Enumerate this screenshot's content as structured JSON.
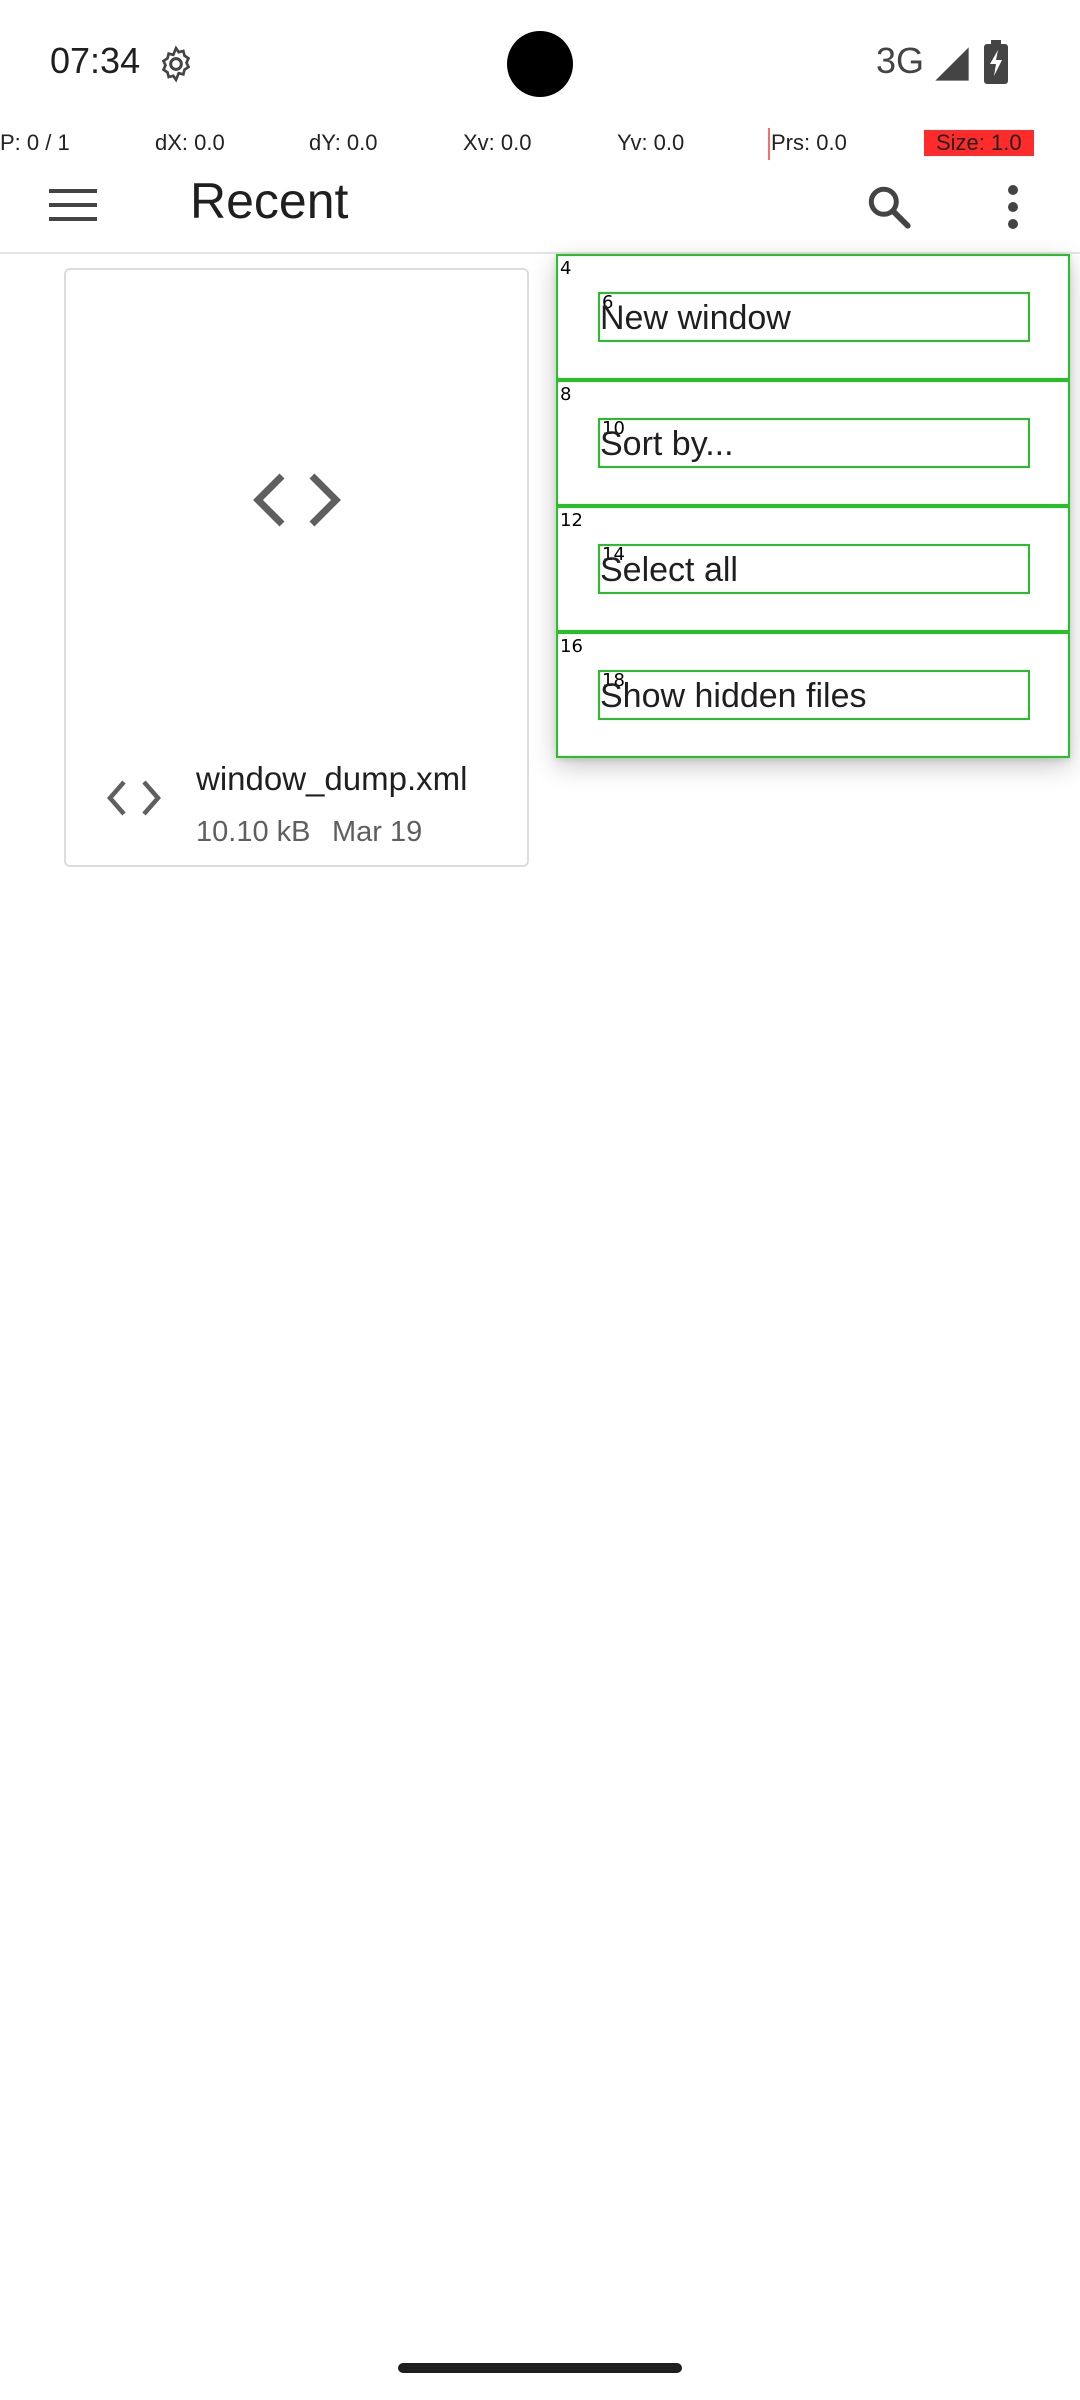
{
  "status_bar": {
    "time": "07:34",
    "network": "3G"
  },
  "debug_overlay": {
    "pointer": "P: 0 / 1",
    "dx": "dX: 0.0",
    "dy": "dY: 0.0",
    "xv": "Xv: 0.0",
    "yv": "Yv: 0.0",
    "prs": "Prs: 0.0",
    "size": "Size: 1.0"
  },
  "app_bar": {
    "title": "Recent",
    "menu_icon": "hamburger-menu-icon",
    "search_icon": "search-icon",
    "more_icon": "more-vert-icon"
  },
  "files": [
    {
      "name": "window_dump.xml",
      "size": "10.10 kB",
      "date": "Mar 19",
      "icon": "code-file-icon"
    }
  ],
  "overflow_menu": {
    "items": [
      {
        "label": "New window",
        "outer_id": "4",
        "inner_id": "6"
      },
      {
        "label": "Sort by...",
        "outer_id": "8",
        "inner_id": "10"
      },
      {
        "label": "Select all",
        "outer_id": "12",
        "inner_id": "14"
      },
      {
        "label": "Show hidden files",
        "outer_id": "16",
        "inner_id": "18"
      }
    ]
  },
  "colors": {
    "debug_highlight": "#22c322",
    "size_badge": "#ff2a2a",
    "text_primary": "#1f1f1f",
    "text_secondary": "#5f5f5f"
  }
}
